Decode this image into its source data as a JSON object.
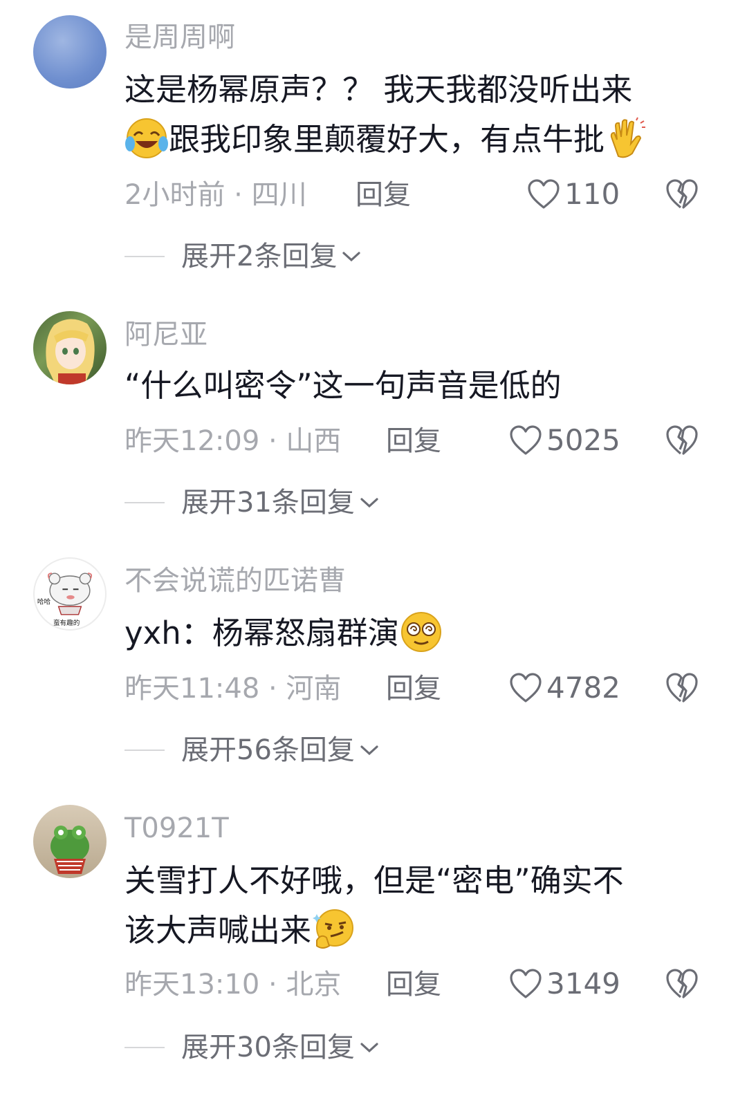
{
  "comments": [
    {
      "username": "是周周啊",
      "text_a": "这是杨幂原声？？ 我天我都没听出来",
      "text_b": "跟我印象里颠覆好大，有点牛批",
      "time_location": "2小时前 · 四川",
      "reply_label": "回复",
      "likes": "110",
      "expand_label": "展开2条回复",
      "avatar_icon": "blue-sky-avatar"
    },
    {
      "username": "阿尼亚",
      "text": "“什么叫密令”这一句声音是低的",
      "time_location": "昨天12:09 · 山西",
      "reply_label": "回复",
      "likes": "5025",
      "expand_label": "展开31条回复",
      "avatar_icon": "anime-girl-avatar"
    },
    {
      "username": "不会说谎的匹诺曹",
      "text": "yxh：杨幂怒扇群演",
      "time_location": "昨天11:48 · 河南",
      "reply_label": "回复",
      "likes": "4782",
      "expand_label": "展开56条回复",
      "avatar_icon": "sheep-cartoon-avatar",
      "avatar_text_a": "哈哈",
      "avatar_text_b": "蛮有趣的"
    },
    {
      "username": "T0921T",
      "text_a": "关雪打人不好哦，但是“密电”确实不",
      "text_b": "该大声喊出来",
      "time_location": "昨天13:10 · 北京",
      "reply_label": "回复",
      "likes": "3149",
      "expand_label": "展开30条回复",
      "avatar_icon": "frog-plush-avatar"
    }
  ],
  "colors": {
    "primary_text": "#161823",
    "secondary_text": "#a6a8ae",
    "action_text": "#6b6d75"
  },
  "icons": [
    "heart-icon",
    "broken-heart-icon",
    "chevron-down-icon",
    "laughing-crying-emoji",
    "clapping-hands-emoji",
    "dazed-emoji",
    "thinking-smirk-emoji"
  ]
}
